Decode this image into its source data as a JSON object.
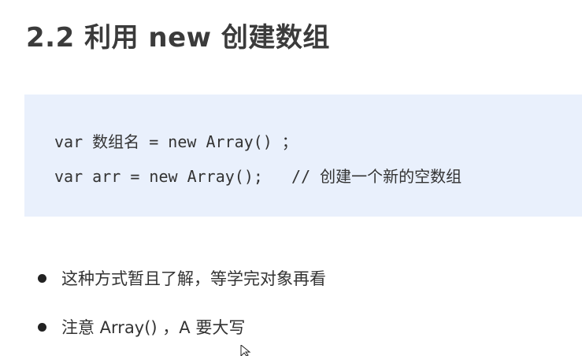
{
  "title": "2.2 利用 new 创建数组",
  "code": {
    "lines": [
      "var 数组名 = new Array() ；",
      "var arr = new Array();   // 创建一个新的空数组"
    ]
  },
  "bullets": [
    "这种方式暂且了解，等学完对象再看",
    "注意 Array() ，A 要大写"
  ],
  "colors": {
    "code_background": "#e9f0fc",
    "text": "#333333",
    "title": "#3b3b3b"
  },
  "icons": {
    "cursor": "mouse-pointer-icon",
    "bullet": "bullet-dot-icon"
  }
}
